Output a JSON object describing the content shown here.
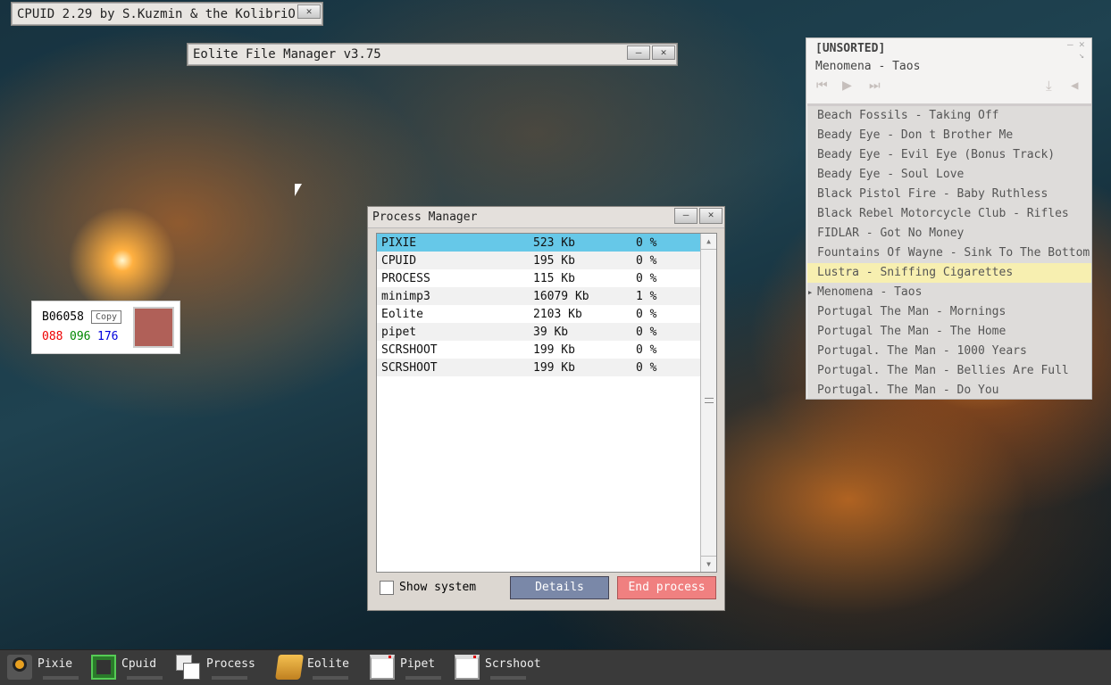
{
  "cpuid_window": {
    "title": "CPUID 2.29 by S.Kuzmin & the KolibriO"
  },
  "eolite_window": {
    "title": "Eolite File Manager v3.75"
  },
  "process_manager": {
    "title": "Process Manager",
    "processes": [
      {
        "name": "PIXIE",
        "mem": "523 Kb",
        "cpu": "0 %",
        "selected": true
      },
      {
        "name": "CPUID",
        "mem": "195 Kb",
        "cpu": "0 %"
      },
      {
        "name": "PROCESS",
        "mem": "115 Kb",
        "cpu": "0 %"
      },
      {
        "name": "minimp3",
        "mem": "16079 Kb",
        "cpu": "1 %"
      },
      {
        "name": "Eolite",
        "mem": "2103 Kb",
        "cpu": "0 %"
      },
      {
        "name": "pipet",
        "mem": "39 Kb",
        "cpu": "0 %"
      },
      {
        "name": "SCRSHOOT",
        "mem": "199 Kb",
        "cpu": "0 %"
      },
      {
        "name": "SCRSHOOT",
        "mem": "199 Kb",
        "cpu": "0 %"
      }
    ],
    "show_system_label": "Show system",
    "show_system_checked": false,
    "details_label": "Details",
    "end_process_label": "End process",
    "colors": {
      "selected": "#66c8e8",
      "details": "#7a88a8",
      "end": "#f08080"
    }
  },
  "color_picker": {
    "hex": "B06058",
    "copy_label": "Copy",
    "r": "088",
    "g": "096",
    "b": "176",
    "swatch": "#b06058"
  },
  "player": {
    "playlist_name": "[UNSORTED]",
    "now_playing": "Menomena - Taos",
    "tracks": [
      "Beach Fossils - Taking Off",
      "Beady Eye - Don t Brother Me",
      "Beady Eye - Evil Eye (Bonus Track)",
      "Beady Eye - Soul Love",
      "Black Pistol Fire - Baby Ruthless",
      "Black Rebel Motorcycle Club - Rifles",
      "FIDLAR - Got No Money",
      "Fountains Of Wayne - Sink To The Bottom",
      "Lustra - Sniffing Cigarettes",
      "Menomena - Taos",
      "Portugal The Man - Mornings",
      "Portugal The Man - The Home",
      "Portugal. The Man - 1000 Years",
      "Portugal. The Man - Bellies Are Full",
      "Portugal. The Man - Do You"
    ],
    "highlighted_index": 8,
    "playing_index": 9
  },
  "taskbar": {
    "items": [
      {
        "label": "Pixie",
        "icon": "speaker-icon"
      },
      {
        "label": "Cpuid",
        "icon": "chip-icon"
      },
      {
        "label": "Process",
        "icon": "windows-icon"
      },
      {
        "label": "Eolite",
        "icon": "folder-icon"
      },
      {
        "label": "Pipet",
        "icon": "window-icon"
      },
      {
        "label": "Scrshoot",
        "icon": "window-icon"
      }
    ]
  }
}
